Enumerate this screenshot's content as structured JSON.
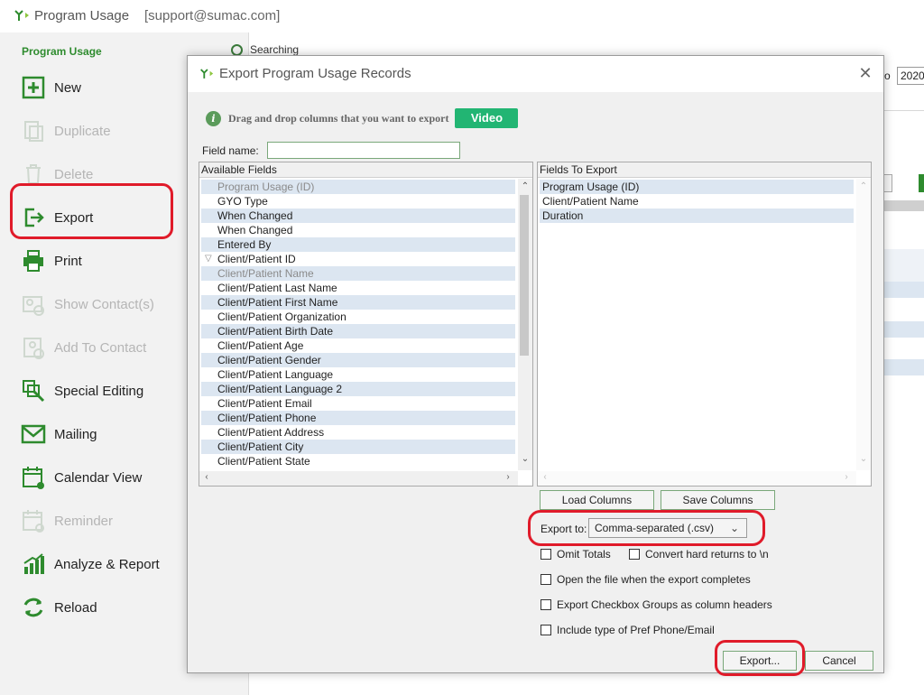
{
  "window": {
    "app_title": "Program Usage",
    "email": "[support@sumac.com]"
  },
  "sidebar": {
    "section_title": "Program Usage",
    "items": [
      {
        "label": "New",
        "icon": "plus-box-icon",
        "enabled": true
      },
      {
        "label": "Duplicate",
        "icon": "duplicate-icon",
        "enabled": false
      },
      {
        "label": "Delete",
        "icon": "trash-icon",
        "enabled": false
      },
      {
        "label": "Export",
        "icon": "export-icon",
        "enabled": true
      },
      {
        "label": "Print",
        "icon": "printer-icon",
        "enabled": true
      },
      {
        "label": "Show Contact(s)",
        "icon": "contact-card-icon",
        "enabled": false
      },
      {
        "label": "Add To Contact",
        "icon": "add-contact-icon",
        "enabled": false
      },
      {
        "label": "Special Editing",
        "icon": "special-edit-icon",
        "enabled": true
      },
      {
        "label": "Mailing",
        "icon": "envelope-icon",
        "enabled": true
      },
      {
        "label": "Calendar View",
        "icon": "calendar-icon",
        "enabled": true
      },
      {
        "label": "Reminder",
        "icon": "reminder-icon",
        "enabled": false
      },
      {
        "label": "Analyze & Report",
        "icon": "bar-chart-icon",
        "enabled": true
      },
      {
        "label": "Reload",
        "icon": "reload-icon",
        "enabled": true
      }
    ]
  },
  "background": {
    "searching_label": "Searching",
    "year_value": "2020",
    "o_label": "o"
  },
  "dialog": {
    "title": "Export Program Usage Records",
    "info_text": "Drag and drop columns that you want to export",
    "video_label": "Video",
    "field_name_label": "Field name:",
    "field_name_value": "",
    "available_header": "Available Fields",
    "available_fields": [
      {
        "label": "Program Usage (ID)",
        "grey": true,
        "alt": true
      },
      {
        "label": "GYO Type",
        "grey": false,
        "alt": false
      },
      {
        "label": "When Changed",
        "grey": false,
        "alt": true
      },
      {
        "label": "When Changed",
        "grey": false,
        "alt": false
      },
      {
        "label": "Entered By",
        "grey": false,
        "alt": true
      },
      {
        "label": "Client/Patient ID",
        "grey": false,
        "alt": false,
        "expander": "▽"
      },
      {
        "label": "Client/Patient Name",
        "grey": true,
        "alt": true
      },
      {
        "label": "Client/Patient Last Name",
        "grey": false,
        "alt": false
      },
      {
        "label": "Client/Patient First Name",
        "grey": false,
        "alt": true
      },
      {
        "label": "Client/Patient Organization",
        "grey": false,
        "alt": false
      },
      {
        "label": "Client/Patient Birth Date",
        "grey": false,
        "alt": true
      },
      {
        "label": "Client/Patient Age",
        "grey": false,
        "alt": false
      },
      {
        "label": "Client/Patient Gender",
        "grey": false,
        "alt": true
      },
      {
        "label": "Client/Patient Language",
        "grey": false,
        "alt": false
      },
      {
        "label": "Client/Patient Language 2",
        "grey": false,
        "alt": true
      },
      {
        "label": "Client/Patient Email",
        "grey": false,
        "alt": false
      },
      {
        "label": "Client/Patient Phone",
        "grey": false,
        "alt": true
      },
      {
        "label": "Client/Patient Address",
        "grey": false,
        "alt": false
      },
      {
        "label": "Client/Patient City",
        "grey": false,
        "alt": true
      },
      {
        "label": "Client/Patient State",
        "grey": false,
        "alt": false
      }
    ],
    "export_header": "Fields To Export",
    "export_fields": [
      {
        "label": "Program Usage (ID)",
        "alt": true
      },
      {
        "label": "Client/Patient Name",
        "alt": false
      },
      {
        "label": "Duration",
        "alt": true
      }
    ],
    "load_columns": "Load Columns",
    "save_columns": "Save Columns",
    "export_to_label": "Export to:",
    "export_to_value": "Comma-separated (.csv)",
    "options": {
      "omit_totals": "Omit Totals",
      "convert_returns": "Convert hard returns to \\n",
      "open_file": "Open the file when the export completes",
      "checkbox_groups": "Export Checkbox Groups as column headers",
      "pref_phone": "Include type of Pref Phone/Email"
    },
    "export_button": "Export...",
    "cancel_button": "Cancel"
  },
  "colors": {
    "accent_green": "#2e8b2e",
    "highlight_red": "#e01b2a",
    "row_alt": "#dce6f1",
    "video_green": "#22b573"
  }
}
